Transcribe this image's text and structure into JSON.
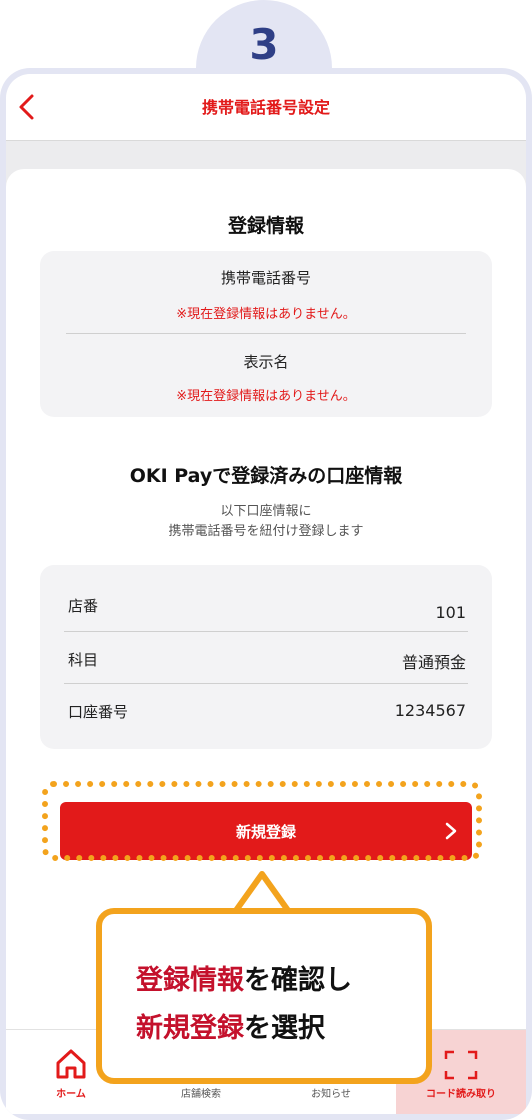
{
  "step": "3",
  "appbar": {
    "title": "携帯電話番号設定"
  },
  "registration_info": {
    "heading": "登録情報",
    "phone_label": "携帯電話番号",
    "phone_value": "※現在登録情報はありません。",
    "display_name_label": "表示名",
    "display_name_value": "※現在登録情報はありません。"
  },
  "account_info": {
    "heading": "OKI Payで登録済みの口座情報",
    "description_line1": "以下口座情報に",
    "description_line2": "携帯電話番号を紐付け登録します",
    "rows": [
      {
        "label": "店番",
        "value": "101"
      },
      {
        "label": "科目",
        "value": "普通預金"
      },
      {
        "label": "口座番号",
        "value": "1234567"
      }
    ]
  },
  "register_button": {
    "label": "新規登録",
    "icon": "chevron-right-icon"
  },
  "tabbar": {
    "items": [
      {
        "label": "ホーム",
        "icon": "home-icon"
      },
      {
        "label": "店舗検索",
        "icon": "store-search-icon"
      },
      {
        "label": "お知らせ",
        "icon": "bell-icon"
      },
      {
        "label": "コード読み取り",
        "icon": "scan-frame-icon"
      }
    ]
  },
  "callout": {
    "line1_highlight": "登録情報",
    "line1_rest": "を確認し",
    "line2_highlight": "新規登録",
    "line2_rest": "を選択"
  },
  "colors": {
    "accent_red": "#e21a1a",
    "highlight_orange": "#f3a31d",
    "step_navy": "#2f3f86",
    "frame": "#e3e5f3"
  }
}
